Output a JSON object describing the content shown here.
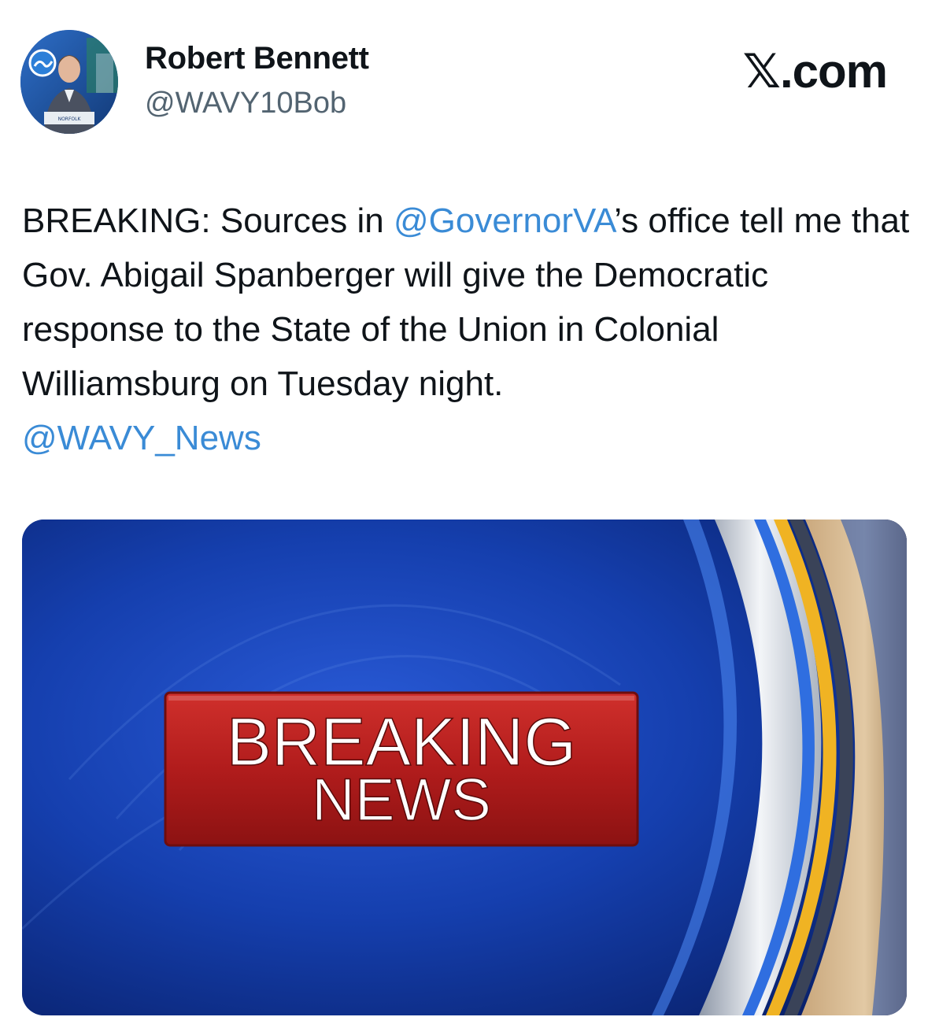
{
  "author": {
    "name": "Robert Bennett",
    "handle": "@WAVY10Bob",
    "avatar_caption": "NORFOLK"
  },
  "site": {
    "logo": "𝕏.com"
  },
  "tweet": {
    "text_before": "BREAKING: Sources in ",
    "mention_1": "@GovernorVA",
    "text_after": "’s office tell me that Gov. Abigail Spanberger will give the Democratic response to the State of the Union in Colonial Williamsburg on Tuesday night.",
    "mention_2": "@WAVY_News"
  },
  "media": {
    "banner_line_1": "BREAKING",
    "banner_line_2": "NEWS"
  },
  "colors": {
    "mention": "#3a8bd6",
    "banner_red": "#b11c1c",
    "background_blue": "#0c2a7a"
  }
}
